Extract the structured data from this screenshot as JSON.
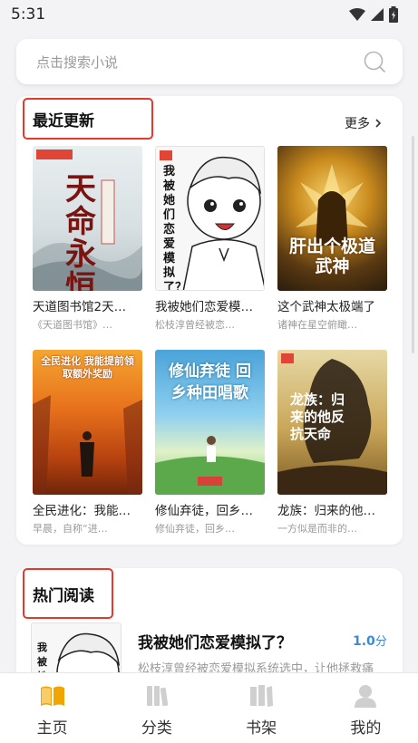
{
  "status_bar": {
    "time": "5:31"
  },
  "search": {
    "placeholder": "点击搜索小说"
  },
  "recent": {
    "title": "最近更新",
    "more_label": "更多",
    "books": [
      {
        "title": "天道图书馆2天…",
        "desc": "《天道图书馆》…",
        "cover_text": "天命永恒",
        "cover_theme": "ink"
      },
      {
        "title": "我被她们恋爱模…",
        "desc": "松枝淳曾经被恋…",
        "cover_text": "我被她们恋爱模拟了？",
        "cover_theme": "manga"
      },
      {
        "title": "这个武神太极端了",
        "desc": "诸神在星空俯瞰…",
        "cover_text": "肝出个极道武神",
        "cover_theme": "golden"
      },
      {
        "title": "全民进化：我能…",
        "desc": "早晨，自称“进…",
        "cover_text": "全民进化 我能提前领取额外奖励",
        "cover_theme": "fire"
      },
      {
        "title": "修仙弃徒，回乡…",
        "desc": "修仙弃徒，回乡…",
        "cover_text": "修仙弃徒 回乡种田唱歌",
        "cover_theme": "sky"
      },
      {
        "title": "龙族：归来的他…",
        "desc": "一方似是而非的…",
        "cover_text": "龙族：归来的他反抗天命",
        "cover_theme": "dusk"
      }
    ]
  },
  "hot": {
    "title": "热门阅读",
    "book": {
      "title": "我被她们恋爱模拟了？",
      "score": "1.0",
      "score_unit": "分",
      "desc": "松枝淳曾经被恋爱模拟系统选中，让他拯救痛"
    }
  },
  "tabs": [
    {
      "label": "主页",
      "icon": "book-open-icon",
      "active": true
    },
    {
      "label": "分类",
      "icon": "category-icon",
      "active": false
    },
    {
      "label": "书架",
      "icon": "bookshelf-icon",
      "active": false
    },
    {
      "label": "我的",
      "icon": "user-icon",
      "active": false
    }
  ],
  "colors": {
    "highlight_border": "#e43a2c",
    "active_tab": "#f0a500",
    "score": "#3b8ad8"
  }
}
